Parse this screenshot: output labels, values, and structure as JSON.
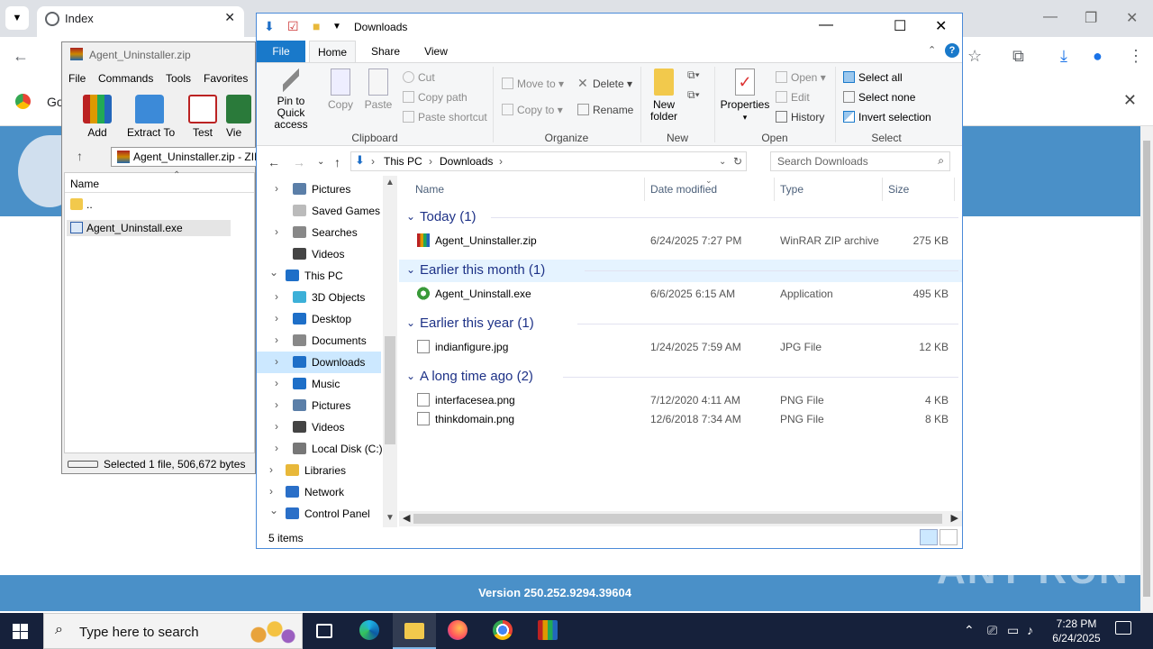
{
  "chrome": {
    "tab_title": "Index",
    "notice_text": "Go",
    "footer_version": "Version 250.252.9294.39604",
    "watermark": "ANY RUN"
  },
  "winrar": {
    "title": "Agent_Uninstaller.zip",
    "menu": [
      "File",
      "Commands",
      "Tools",
      "Favorites"
    ],
    "tools": [
      "Add",
      "Extract To",
      "Test",
      "Vie"
    ],
    "address": "Agent_Uninstaller.zip - ZIP",
    "column_name": "Name",
    "files": [
      "..",
      "Agent_Uninstall.exe"
    ],
    "status": "Selected 1 file, 506,672 bytes"
  },
  "explorer": {
    "title": "Downloads",
    "tabs": {
      "file": "File",
      "home": "Home",
      "share": "Share",
      "view": "View"
    },
    "ribbon": {
      "pin": "Pin to Quick access",
      "copy": "Copy",
      "paste": "Paste",
      "cut": "Cut",
      "copy_path": "Copy path",
      "paste_shortcut": "Paste shortcut",
      "clipboard": "Clipboard",
      "move_to": "Move to",
      "copy_to": "Copy to",
      "delete": "Delete",
      "rename": "Rename",
      "organize": "Organize",
      "new_folder": "New folder",
      "new": "New",
      "properties": "Properties",
      "open_btn": "Open",
      "edit": "Edit",
      "history": "History",
      "open": "Open",
      "select_all": "Select all",
      "select_none": "Select none",
      "invert_selection": "Invert selection",
      "select": "Select"
    },
    "address": {
      "this_pc": "This PC",
      "downloads": "Downloads"
    },
    "search_placeholder": "Search Downloads",
    "nav": [
      {
        "label": "Pictures"
      },
      {
        "label": "Saved Games"
      },
      {
        "label": "Searches"
      },
      {
        "label": "Videos"
      },
      {
        "label": "This PC"
      },
      {
        "label": "3D Objects"
      },
      {
        "label": "Desktop"
      },
      {
        "label": "Documents"
      },
      {
        "label": "Downloads"
      },
      {
        "label": "Music"
      },
      {
        "label": "Pictures"
      },
      {
        "label": "Videos"
      },
      {
        "label": "Local Disk (C:)"
      },
      {
        "label": "Libraries"
      },
      {
        "label": "Network"
      },
      {
        "label": "Control Panel"
      }
    ],
    "columns": {
      "name": "Name",
      "date": "Date modified",
      "type": "Type",
      "size": "Size"
    },
    "groups": [
      {
        "label": "Today (1)",
        "files": [
          {
            "name": "Agent_Uninstaller.zip",
            "date": "6/24/2025 7:27 PM",
            "type": "WinRAR ZIP archive",
            "size": "275 KB"
          }
        ]
      },
      {
        "label": "Earlier this month (1)",
        "files": [
          {
            "name": "Agent_Uninstall.exe",
            "date": "6/6/2025 6:15 AM",
            "type": "Application",
            "size": "495 KB"
          }
        ]
      },
      {
        "label": "Earlier this year (1)",
        "files": [
          {
            "name": "indianfigure.jpg",
            "date": "1/24/2025 7:59 AM",
            "type": "JPG File",
            "size": "12 KB"
          }
        ]
      },
      {
        "label": "A long time ago (2)",
        "files": [
          {
            "name": "interfacesea.png",
            "date": "7/12/2020 4:11 AM",
            "type": "PNG File",
            "size": "4 KB"
          },
          {
            "name": "thinkdomain.png",
            "date": "12/6/2018 7:34 AM",
            "type": "PNG File",
            "size": "8 KB"
          }
        ]
      }
    ],
    "status": "5 items"
  },
  "taskbar": {
    "search_placeholder": "Type here to search",
    "time": "7:28 PM",
    "date": "6/24/2025"
  },
  "colors": {
    "accent": "#1979ca",
    "taskbar": "#16213b",
    "page_blue": "#4a90c8",
    "selection": "#cce8ff",
    "group_header": "#1e3287"
  }
}
